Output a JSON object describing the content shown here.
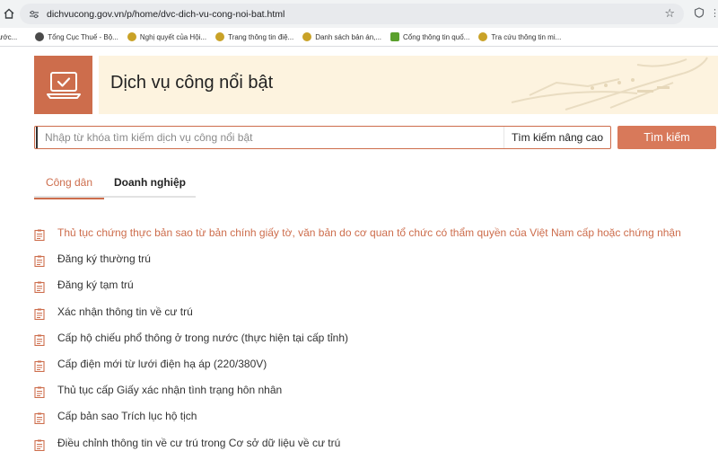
{
  "browser": {
    "url": "dichvucong.gov.vn/p/home/dvc-dich-vu-cong-noi-bat.html",
    "icons": [
      "home-icon",
      "site-info-icon",
      "star-icon",
      "extension-icon"
    ],
    "bookmarks": [
      {
        "label": "ước...",
        "icon": "bookmark-icon",
        "color": "#9aa0a6"
      },
      {
        "label": "Tổng Cục Thuế - Bộ...",
        "icon": "tax-icon",
        "color": "#4a4a4a"
      },
      {
        "label": "Nghị quyết của Hội...",
        "icon": "emblem-icon",
        "color": "#c9a227"
      },
      {
        "label": "Trang thông tin điệ...",
        "icon": "emblem-icon",
        "color": "#c9a227"
      },
      {
        "label": "Danh sách bản án,...",
        "icon": "emblem-icon",
        "color": "#c9a227"
      },
      {
        "label": "Cổng thông tin quố...",
        "icon": "leaf-icon",
        "color": "#5aa02c"
      },
      {
        "label": "Tra cứu thông tin mi...",
        "icon": "emblem-icon",
        "color": "#c9a227"
      }
    ]
  },
  "colors": {
    "accent": "#cd6d4c",
    "button": "#d8795a",
    "banner_bg": "#fdf3df"
  },
  "hero": {
    "title": "Dịch vụ công nổi bật",
    "icon": "laptop-check-icon"
  },
  "search": {
    "placeholder": "Nhập từ khóa tìm kiếm dịch vụ công nổi bật",
    "advanced_label": "Tìm kiếm nâng cao",
    "button_label": "Tìm kiếm"
  },
  "tabs": [
    {
      "label": "Công dân",
      "active": true
    },
    {
      "label": "Doanh nghiệp",
      "active": false
    }
  ],
  "services": [
    {
      "label": "Thủ tục chứng thực bản sao từ bản chính giấy tờ, văn bản do cơ quan tổ chức có thẩm quyền của Việt Nam cấp hoặc chứng nhận",
      "highlight": true
    },
    {
      "label": "Đăng ký thường trú",
      "highlight": false
    },
    {
      "label": "Đăng ký tạm trú",
      "highlight": false
    },
    {
      "label": "Xác nhận thông tin về cư trú",
      "highlight": false
    },
    {
      "label": "Cấp hộ chiếu phổ thông ở trong nước (thực hiện tại cấp tỉnh)",
      "highlight": false
    },
    {
      "label": "Cấp điện mới từ lưới điện hạ áp (220/380V)",
      "highlight": false
    },
    {
      "label": "Thủ tục cấp Giấy xác nhận tình trạng hôn nhân",
      "highlight": false
    },
    {
      "label": "Cấp bản sao Trích lục hộ tịch",
      "highlight": false
    },
    {
      "label": "Điều chỉnh thông tin về cư trú trong Cơ sở dữ liệu về cư trú",
      "highlight": false
    }
  ]
}
